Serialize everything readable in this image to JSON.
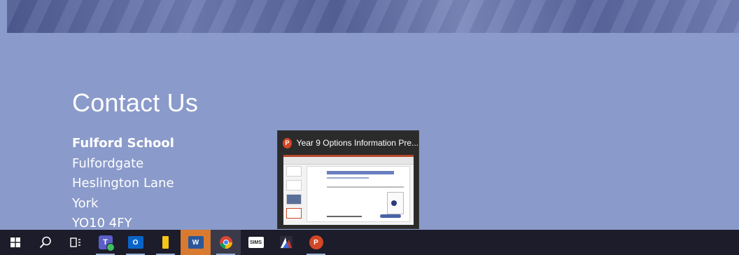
{
  "page": {
    "contact_title": "Contact Us",
    "address": {
      "school": "Fulford School",
      "line1": "Fulfordgate",
      "line2": "Heslington Lane",
      "line3": "York",
      "postcode": "YO10 4FY"
    }
  },
  "preview": {
    "app_badge": "P",
    "title": "Year 9 Options Information Pre..."
  },
  "taskbar": {
    "sims_label": "SIMS",
    "powerpoint_badge": "P",
    "word_badge": "W",
    "outlook_badge": "O",
    "teams_badge": "T",
    "colors": {
      "background": "#1c1c2a",
      "active": "#d87a2f",
      "accent": "#9ab0d8"
    }
  },
  "colors": {
    "page_background": "#8a9aca",
    "banner": "#56639a",
    "powerpoint": "#d24726"
  }
}
